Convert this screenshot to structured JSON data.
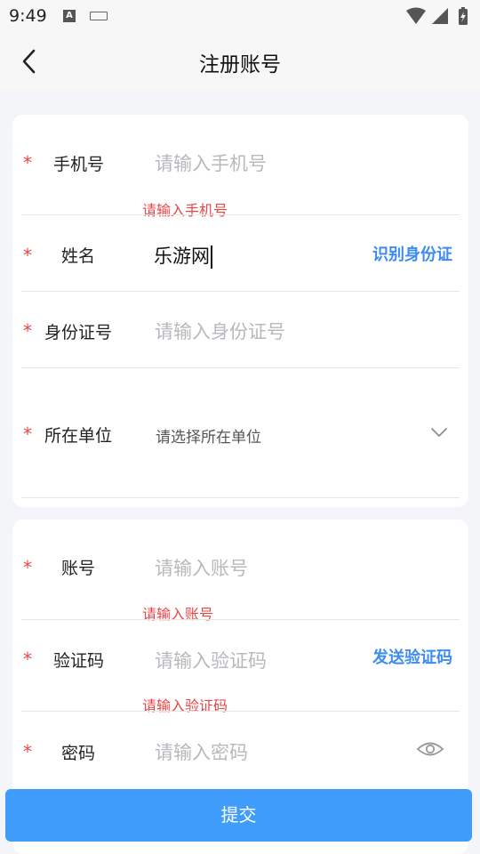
{
  "status_bar": {
    "time": "9:49",
    "a_badge": "A"
  },
  "nav": {
    "title": "注册账号"
  },
  "form": {
    "phone": {
      "label": "手机号",
      "placeholder": "请输入手机号",
      "error": "请输入手机号"
    },
    "name": {
      "label": "姓名",
      "value": "乐游网",
      "action": "识别身份证"
    },
    "id_number": {
      "label": "身份证号",
      "placeholder": "请输入身份证号"
    },
    "unit": {
      "label": "所在单位",
      "placeholder": "请选择所在单位"
    },
    "account": {
      "label": "账号",
      "placeholder": "请输入账号",
      "error": "请输入账号"
    },
    "code": {
      "label": "验证码",
      "placeholder": "请输入验证码",
      "action": "发送验证码",
      "error": "请输入验证码"
    },
    "password": {
      "label": "密码",
      "placeholder": "请输入密码"
    },
    "required_mark": "*"
  },
  "submit": {
    "label": "提交"
  },
  "colors": {
    "accent": "#3f9cfa",
    "error": "#e84545",
    "link": "#3d8cf0"
  }
}
